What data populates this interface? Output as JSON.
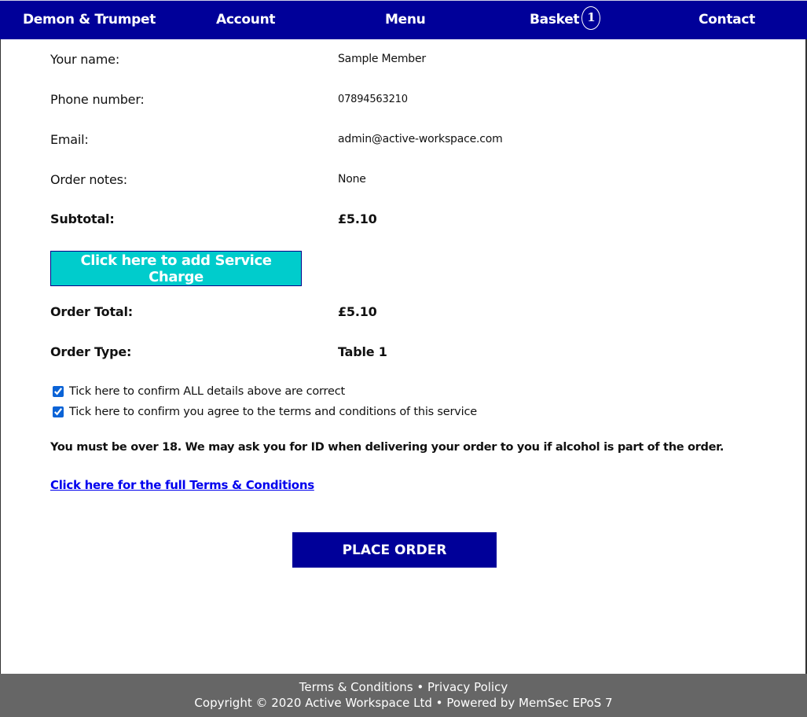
{
  "nav": {
    "brand": "Demon & Trumpet",
    "account": "Account",
    "menu": "Menu",
    "basket": "Basket",
    "basket_count": "1",
    "contact": "Contact"
  },
  "details": {
    "name_label": "Your name:",
    "name_value": "Sample Member",
    "phone_label": "Phone number:",
    "phone_value": "07894563210",
    "email_label": "Email:",
    "email_value": "admin@active-workspace.com",
    "notes_label": "Order notes:",
    "notes_value": "None",
    "subtotal_label": "Subtotal:",
    "subtotal_value": "£5.10",
    "service_charge_button": "Click here to add Service Charge",
    "total_label": "Order Total:",
    "total_value": "£5.10",
    "type_label": "Order Type:",
    "type_value": "Table 1"
  },
  "confirmations": [
    {
      "label": "Tick here to confirm ALL details above are correct",
      "checked": true
    },
    {
      "label": "Tick here to confirm you agree to the terms and conditions of this service",
      "checked": true
    }
  ],
  "age_warning": "You must be over 18. We may ask you for ID when delivering your order to you if alcohol is part of the order.",
  "terms_link": "Click here for the full Terms & Conditions",
  "place_order_button": "PLACE ORDER",
  "colors": {
    "nav_bg": "#000099",
    "service_button_bg": "#00cccc",
    "footer_bg": "#666666",
    "link": "#0000ee"
  },
  "footer": {
    "terms": "Terms & Conditions",
    "separator": "•",
    "privacy": "Privacy Policy",
    "copyright": "Copyright © 2020 Active Workspace Ltd",
    "powered_by": "Powered by MemSec EPoS 7"
  }
}
